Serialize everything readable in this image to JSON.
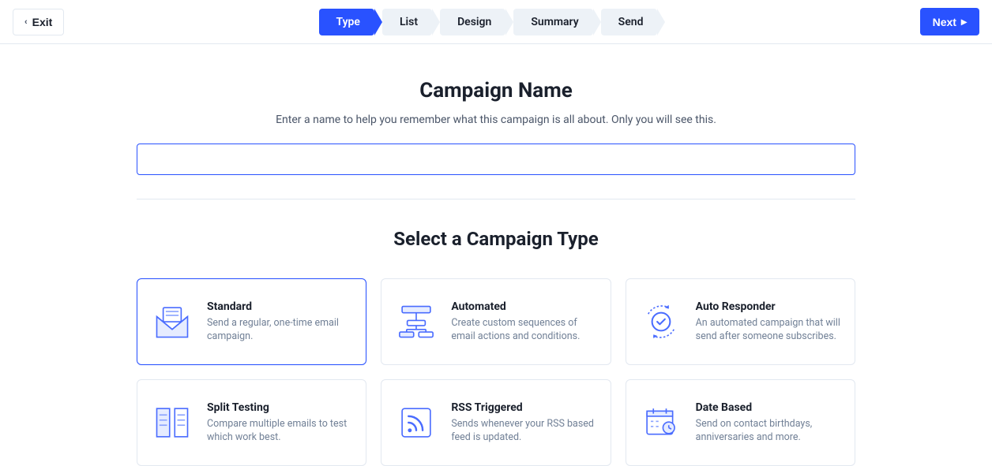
{
  "header": {
    "exit_label": "Exit",
    "next_label": "Next",
    "steps": [
      {
        "label": "Type",
        "active": true
      },
      {
        "label": "List",
        "active": false
      },
      {
        "label": "Design",
        "active": false
      },
      {
        "label": "Summary",
        "active": false
      },
      {
        "label": "Send",
        "active": false
      }
    ]
  },
  "main": {
    "title": "Campaign Name",
    "subtitle": "Enter a name to help you remember what this campaign is all about. Only you will see this.",
    "name_value": "",
    "name_placeholder": "",
    "section_title": "Select a Campaign Type",
    "types": [
      {
        "title": "Standard",
        "desc": "Send a regular, one-time email campaign.",
        "selected": true
      },
      {
        "title": "Automated",
        "desc": "Create custom sequences of email actions and conditions.",
        "selected": false
      },
      {
        "title": "Auto Responder",
        "desc": "An automated campaign that will send after someone subscribes.",
        "selected": false
      },
      {
        "title": "Split Testing",
        "desc": "Compare multiple emails to test which work best.",
        "selected": false
      },
      {
        "title": "RSS Triggered",
        "desc": "Sends whenever your RSS based feed is updated.",
        "selected": false
      },
      {
        "title": "Date Based",
        "desc": "Send on contact birthdays, anniversaries and more.",
        "selected": false
      }
    ]
  },
  "colors": {
    "accent": "#2952ff",
    "muted_bg": "#edf2f7",
    "border": "#e2e8f0",
    "text_muted": "#718096"
  }
}
